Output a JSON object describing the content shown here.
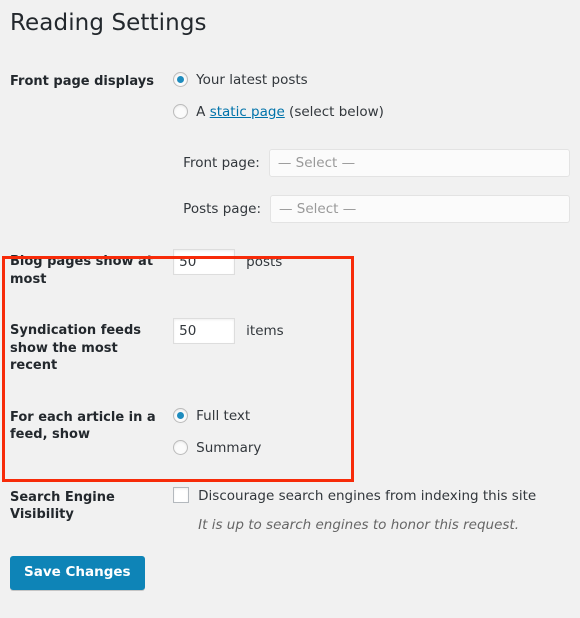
{
  "header": {
    "title": "Reading Settings"
  },
  "front_page": {
    "label": "Front page displays",
    "options": [
      {
        "label": "Your latest posts",
        "selected": true
      },
      {
        "label_before": "A ",
        "link": "static page",
        "label_after": " (select below)",
        "selected": false
      }
    ],
    "selects": [
      {
        "label": "Front page:",
        "value": "— Select —"
      },
      {
        "label": "Posts page:",
        "value": "— Select —"
      }
    ]
  },
  "blog_pages": {
    "label": "Blog pages show at most",
    "value": "50",
    "suffix": "posts"
  },
  "syndication": {
    "label": "Syndication feeds show the most recent",
    "value": "50",
    "suffix": "items"
  },
  "feed_article": {
    "label": "For each article in a feed, show",
    "options": [
      {
        "label": "Full text",
        "selected": true
      },
      {
        "label": "Summary",
        "selected": false
      }
    ]
  },
  "search_visibility": {
    "label": "Search Engine Visibility",
    "checkbox_label": "Discourage search engines from indexing this site",
    "checked": false,
    "hint": "It is up to search engines to honor this request."
  },
  "submit": {
    "label": "Save Changes"
  },
  "annotation": {
    "highlight_color": "#f72b09"
  },
  "colors": {
    "accent": "#0073aa",
    "button": "#0e84b7",
    "radio_dot": "#1e8cbe",
    "page_bg": "#f1f1f1",
    "title": "#23282d"
  }
}
